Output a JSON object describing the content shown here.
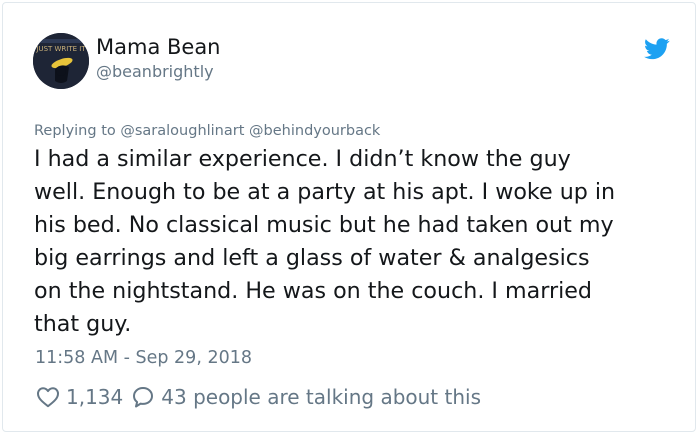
{
  "author": {
    "display_name": "Mama Bean",
    "handle": "@beanbrightly",
    "avatar_icon": "profile-avatar-dark-book-cover"
  },
  "platform_icon": "twitter-bird-icon",
  "reply": {
    "prefix": "Replying to",
    "mentions": [
      "@saraloughlinart",
      "@behindyourback"
    ]
  },
  "tweet": {
    "lines": [
      "I had a similar experience. I didn’t know the guy",
      "well. Enough to be at a party at his apt. I woke up in",
      "his bed. No classical music but he had taken out my",
      "big earrings and left a glass of water & analgesics",
      "on the nightstand. He was on the couch. I married",
      "that guy."
    ]
  },
  "timestamp": "11:58 AM - Sep 29, 2018",
  "engagement": {
    "likes": "1,134",
    "talking": "43 people are talking about this"
  },
  "colors": {
    "text": "#14171a",
    "secondary": "#657786",
    "twitter_blue": "#1da1f2",
    "border": "#e1e8ed"
  }
}
